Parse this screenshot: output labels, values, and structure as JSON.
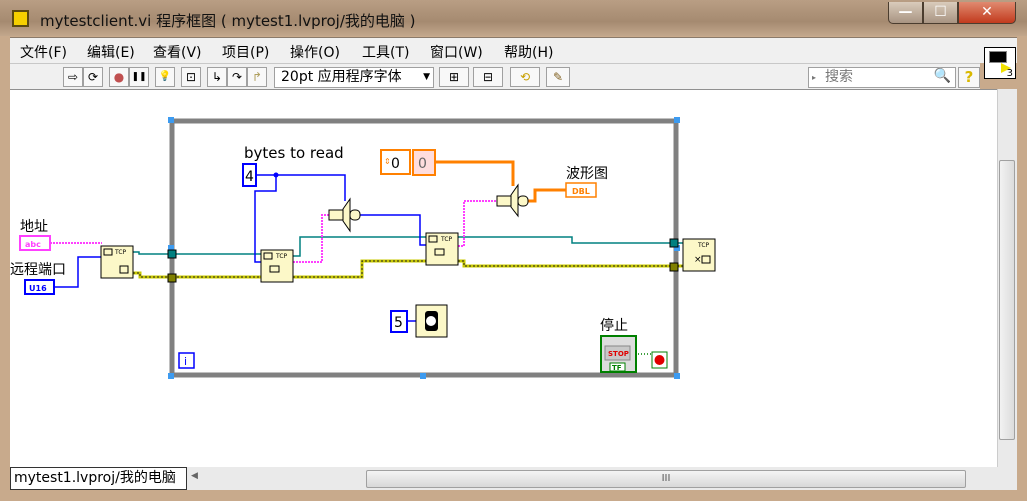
{
  "window": {
    "title": "mytestclient.vi 程序框图 ( mytest1.lvproj/我的电脑 )",
    "min": "—",
    "max": "☐",
    "close": "✕"
  },
  "menu": [
    "文件(F)",
    "编辑(E)",
    "查看(V)",
    "项目(P)",
    "操作(O)",
    "工具(T)",
    "窗口(W)",
    "帮助(H)"
  ],
  "toolbar": {
    "run": "⇨",
    "run_continuous": "⟳",
    "abort": "●",
    "pause": "❚❚",
    "highlight": "💡",
    "retain": "⊡",
    "step_into": "↳",
    "step_over": "↷",
    "step_out": "↱",
    "font": "20pt 应用程序字体",
    "align": "⊞",
    "distribute": "⊟",
    "reorder": "⟲",
    "cleanup": "✎",
    "search_placeholder": "搜索",
    "help": "?",
    "vi_icon_number": "3"
  },
  "diagram": {
    "labels": {
      "address": "地址",
      "port": "远程端口",
      "bytes_to_read": "bytes to read",
      "waveform": "波形图",
      "stop": "停止"
    },
    "constants": {
      "bytes": "4",
      "wait_ms": "5",
      "array_index": "0",
      "array_value": "0"
    },
    "terminals": {
      "address_type": "abc",
      "port_type": "U16",
      "waveform_type": "DBL",
      "stop_text": "STOP",
      "stop_type": "TF",
      "iteration": "i"
    },
    "node_text": "TCP"
  },
  "status": {
    "context": "mytest1.lvproj/我的电脑",
    "scroll_grip": "III"
  },
  "colors": {
    "string_wire": "#ff40ff",
    "int_wire": "#0000ff",
    "refnum_wire": "#008080",
    "error_wire": "#c8c800",
    "dbl_wire": "#ff8000",
    "bool_wire": "#008000"
  }
}
